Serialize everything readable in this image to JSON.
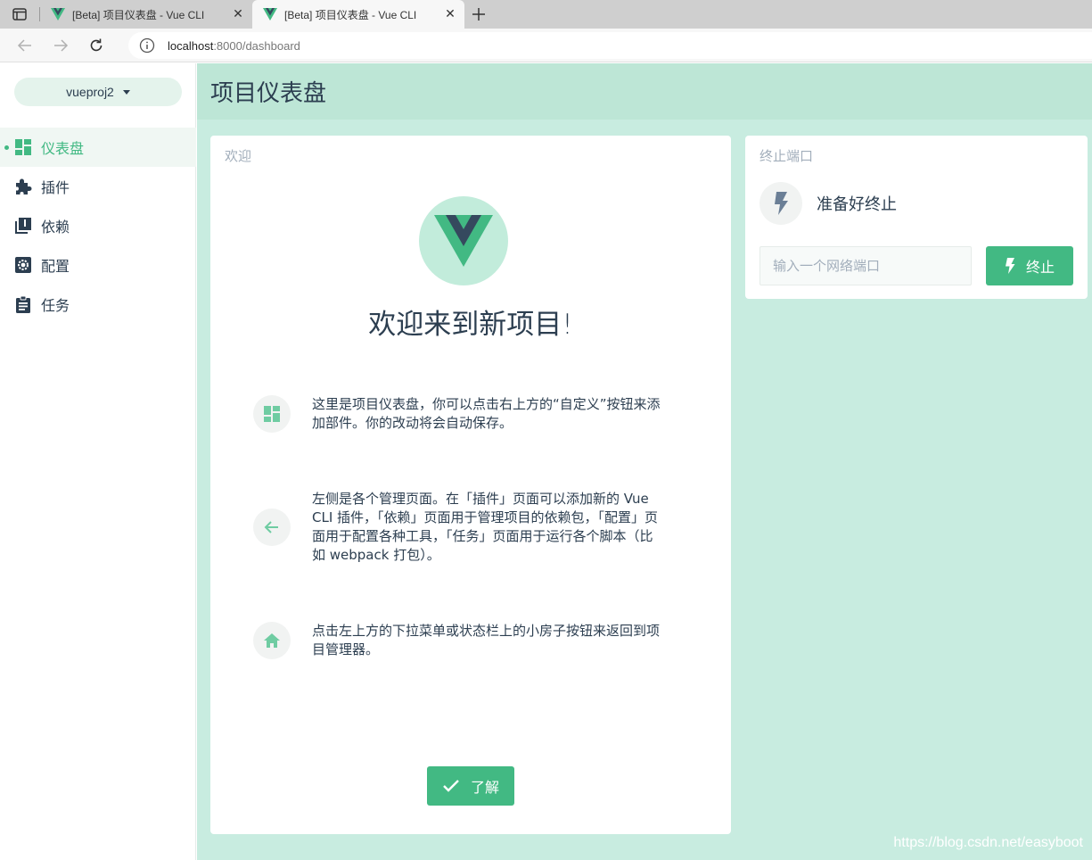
{
  "browser": {
    "tabs": [
      {
        "title": "[Beta] 项目仪表盘 - Vue CLI",
        "active": false
      },
      {
        "title": "[Beta] 项目仪表盘 - Vue CLI",
        "active": true
      }
    ],
    "url_host": "localhost",
    "url_path": ":8000/dashboard"
  },
  "sidebar": {
    "project_name": "vueproj2",
    "items": [
      {
        "label": "仪表盘",
        "icon": "dashboard-icon",
        "active": true
      },
      {
        "label": "插件",
        "icon": "puzzle-icon",
        "active": false
      },
      {
        "label": "依赖",
        "icon": "library-books-icon",
        "active": false
      },
      {
        "label": "配置",
        "icon": "settings-icon",
        "active": false
      },
      {
        "label": "任务",
        "icon": "clipboard-icon",
        "active": false
      }
    ]
  },
  "header": {
    "title": "项目仪表盘"
  },
  "welcome": {
    "card_title": "欢迎",
    "heading": "欢迎来到新项目!",
    "tips": [
      {
        "icon": "dashboard-icon",
        "text": "这里是项目仪表盘，你可以点击右上方的“自定义”按钮来添加部件。你的改动将会自动保存。"
      },
      {
        "icon": "arrow-left-icon",
        "text": "左侧是各个管理页面。在「插件」页面可以添加新的 Vue CLI 插件，「依赖」页面用于管理项目的依赖包，「配置」页面用于配置各种工具，「任务」页面用于运行各个脚本（比如 webpack 打包）。"
      },
      {
        "icon": "home-icon",
        "text": "点击左上方的下拉菜单或状态栏上的小房子按钮来返回到项目管理器。"
      }
    ],
    "ok_label": "了解"
  },
  "kill_port": {
    "card_title": "终止端口",
    "status": "准备好终止",
    "input_placeholder": "输入一个网络端口",
    "input_value": "",
    "button_label": "终止"
  },
  "watermark": "https://blog.csdn.net/easyboot",
  "colors": {
    "accent": "#42b983",
    "background": "#c8ece0",
    "header": "#bde6d6",
    "text": "#2c3e50"
  }
}
